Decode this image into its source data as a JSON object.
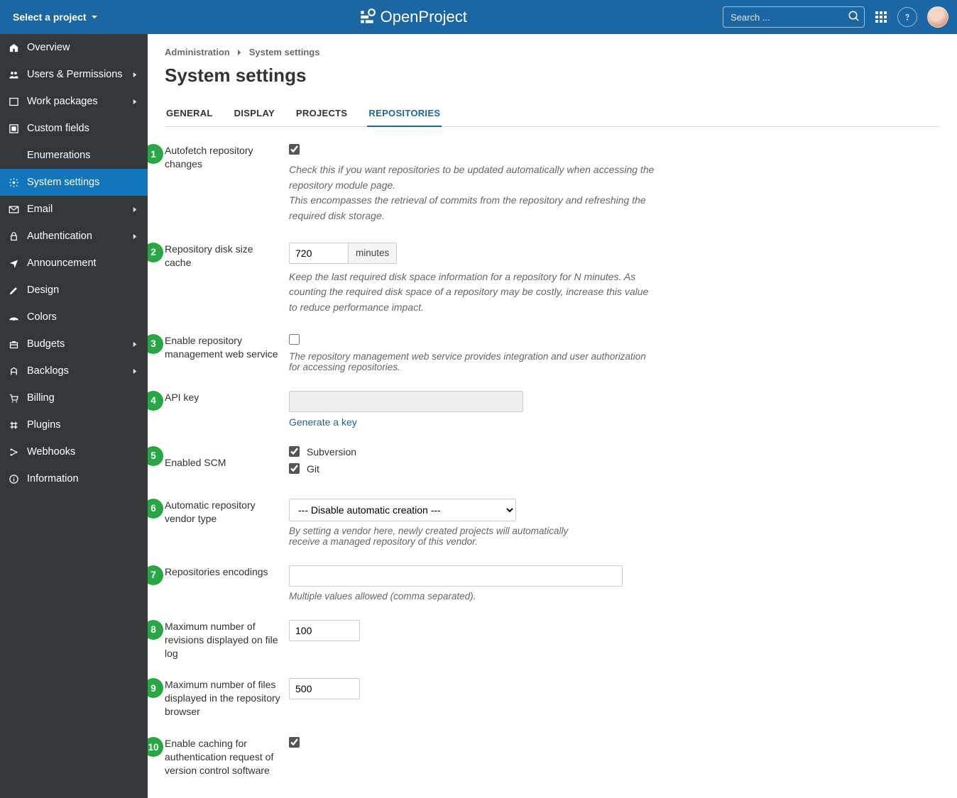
{
  "header": {
    "project_select": "Select a project",
    "logo_text": "OpenProject",
    "search_placeholder": "Search ..."
  },
  "sidebar": {
    "items": [
      {
        "label": "Overview",
        "arrow": false
      },
      {
        "label": "Users & Permissions",
        "arrow": true
      },
      {
        "label": "Work packages",
        "arrow": true
      },
      {
        "label": "Custom fields",
        "arrow": false
      },
      {
        "label": "Enumerations",
        "arrow": false
      },
      {
        "label": "System settings",
        "arrow": false,
        "active": true
      },
      {
        "label": "Email",
        "arrow": true
      },
      {
        "label": "Authentication",
        "arrow": true
      },
      {
        "label": "Announcement",
        "arrow": false
      },
      {
        "label": "Design",
        "arrow": false
      },
      {
        "label": "Colors",
        "arrow": false
      },
      {
        "label": "Budgets",
        "arrow": true
      },
      {
        "label": "Backlogs",
        "arrow": true
      },
      {
        "label": "Billing",
        "arrow": false
      },
      {
        "label": "Plugins",
        "arrow": false
      },
      {
        "label": "Webhooks",
        "arrow": false
      },
      {
        "label": "Information",
        "arrow": false
      }
    ]
  },
  "breadcrumb": {
    "seg1": "Administration",
    "seg2": "System settings"
  },
  "page_title": "System settings",
  "tabs": {
    "general": "GENERAL",
    "display": "DISPLAY",
    "projects": "PROJECTS",
    "repositories": "REPOSITORIES"
  },
  "fields": {
    "autofetch": {
      "label": "Autofetch repository changes",
      "checked": true,
      "desc1": "Check this if you want repositories to be updated automatically when accessing the repository module page.",
      "desc2": "This encompasses the retrieval of commits from the repository and refreshing the required disk storage."
    },
    "diskcache": {
      "label": "Repository disk size cache",
      "value": "720",
      "unit": "minutes",
      "desc": "Keep the last required disk space information for a repository for N minutes. As counting the required disk space of a repository may be costly, increase this value to reduce performance impact."
    },
    "mgmt": {
      "label": "Enable repository management web service",
      "checked": false,
      "desc": "The repository management web service provides integration and user authorization for accessing repositories."
    },
    "apikey": {
      "label": "API key",
      "value": "",
      "link": "Generate a key"
    },
    "scm": {
      "label": "Enabled SCM",
      "svn": "Subversion",
      "svn_checked": true,
      "git": "Git",
      "git_checked": true
    },
    "vendor": {
      "label": "Automatic repository vendor type",
      "value": "--- Disable automatic creation ---",
      "desc": "By setting a vendor here, newly created projects will automatically receive a managed repository of this vendor."
    },
    "encodings": {
      "label": "Repositories encodings",
      "value": "",
      "hint": "Multiple values allowed (comma separated)."
    },
    "maxrev": {
      "label": "Maximum number of revisions displayed on file log",
      "value": "100"
    },
    "maxfiles": {
      "label": "Maximum number of files displayed in the repository browser",
      "value": "500"
    },
    "cacheauth": {
      "label": "Enable caching for authentication request of version control software",
      "checked": true
    }
  },
  "badges": [
    "1",
    "2",
    "3",
    "4",
    "5",
    "6",
    "7",
    "8",
    "9",
    "10"
  ]
}
